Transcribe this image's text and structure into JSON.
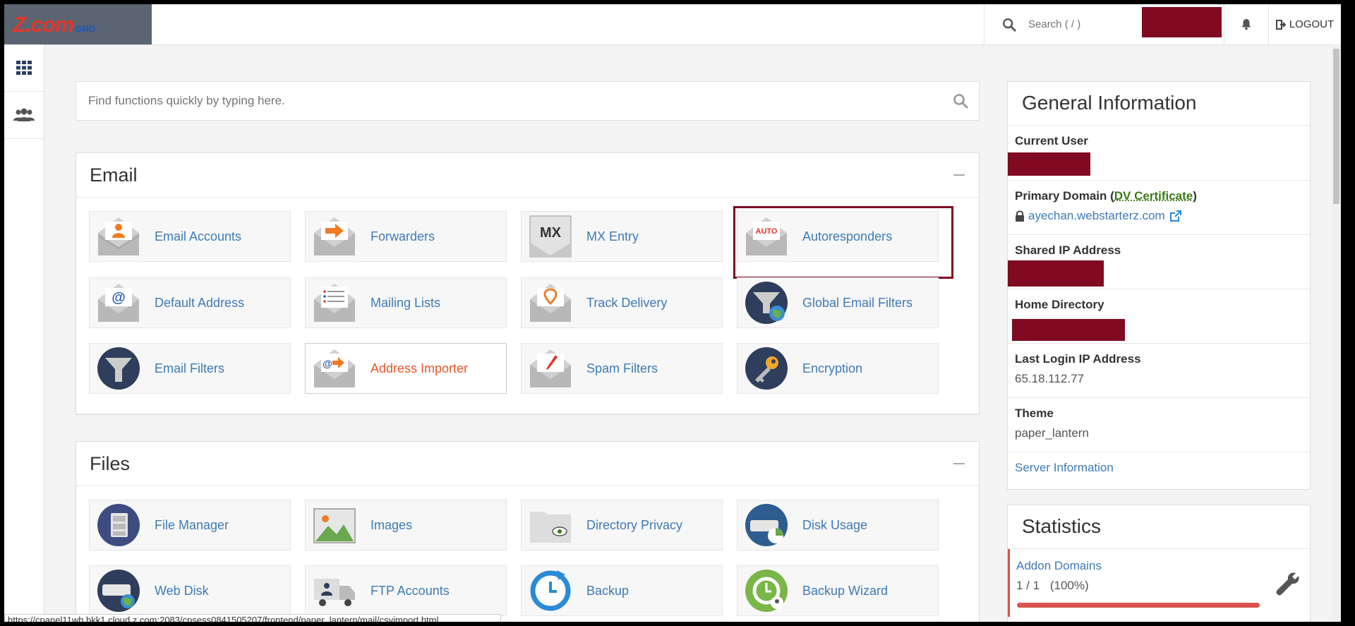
{
  "brand": {
    "logo_main": "Z.com",
    "logo_sub": "GMO"
  },
  "topbar": {
    "search_placeholder": "Search ( / )",
    "logout_label": "LOGOUT"
  },
  "finder": {
    "placeholder": "Find functions quickly by typing here."
  },
  "email": {
    "title": "Email",
    "items": [
      {
        "label": "Email Accounts",
        "icon": "envelope-person-icon"
      },
      {
        "label": "Forwarders",
        "icon": "envelope-arrow-icon"
      },
      {
        "label": "MX Entry",
        "icon": "mx-entry-icon",
        "badge": "MX"
      },
      {
        "label": "Autoresponders",
        "icon": "envelope-auto-icon",
        "badge": "AUTO"
      },
      {
        "label": "Default Address",
        "icon": "envelope-at-icon"
      },
      {
        "label": "Mailing Lists",
        "icon": "mailing-list-icon"
      },
      {
        "label": "Track Delivery",
        "icon": "envelope-pin-icon"
      },
      {
        "label": "Global Email Filters",
        "icon": "global-filter-icon"
      },
      {
        "label": "Email Filters",
        "icon": "funnel-icon"
      },
      {
        "label": "Address Importer",
        "icon": "envelope-at-arrow-icon"
      },
      {
        "label": "Spam Filters",
        "icon": "envelope-pen-icon"
      },
      {
        "label": "Encryption",
        "icon": "key-icon"
      }
    ]
  },
  "files": {
    "title": "Files",
    "items": [
      {
        "label": "File Manager",
        "icon": "file-cabinet-icon"
      },
      {
        "label": "Images",
        "icon": "image-icon"
      },
      {
        "label": "Directory Privacy",
        "icon": "folder-eye-icon"
      },
      {
        "label": "Disk Usage",
        "icon": "disk-chart-icon"
      },
      {
        "label": "Web Disk",
        "icon": "web-disk-icon"
      },
      {
        "label": "FTP Accounts",
        "icon": "ftp-truck-icon"
      },
      {
        "label": "Backup",
        "icon": "backup-clock-icon"
      },
      {
        "label": "Backup Wizard",
        "icon": "backup-wizard-icon"
      }
    ]
  },
  "general": {
    "title": "General Information",
    "current_user_label": "Current User",
    "primary_domain_label": "Primary Domain (",
    "primary_domain_cert": "DV Certificate",
    "primary_domain_close": ")",
    "primary_domain_value": "ayechan.webstarterz.com",
    "shared_ip_label": "Shared IP Address",
    "home_dir_label": "Home Directory",
    "last_login_label": "Last Login IP Address",
    "last_login_value": "65.18.112.77",
    "theme_label": "Theme",
    "theme_value": "paper_lantern",
    "server_info_link": "Server Information"
  },
  "statistics": {
    "title": "Statistics",
    "addon_domains_label": "Addon Domains",
    "addon_domains_value": "1 / 1",
    "addon_domains_percent": "(100%)",
    "addon_domains_fraction": 1.0
  },
  "status_bar": {
    "url": "https://cpanel11wh.bkk1.cloud.z.com:2083/cpsess0841505207/frontend/paper_lantern/mail/csvimport.html"
  },
  "colors": {
    "redaction": "#7f0a21",
    "link": "#3e7ab5",
    "accent_orange": "#e5572b"
  }
}
